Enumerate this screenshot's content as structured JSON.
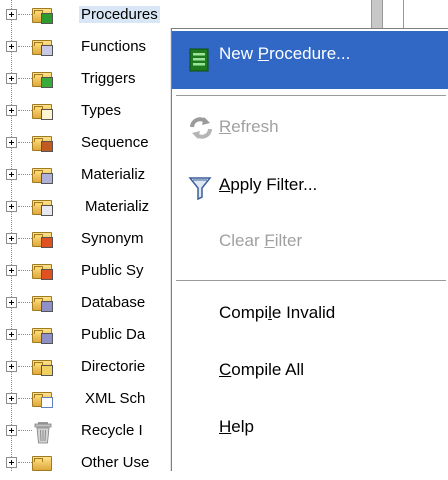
{
  "tree": {
    "items": [
      {
        "label": "Procedures",
        "icon": "procedures-folder-icon",
        "color": "#2e9b2e"
      },
      {
        "label": "Functions",
        "icon": "functions-folder-icon",
        "color": "#6d6d9c"
      },
      {
        "label": "Triggers",
        "icon": "triggers-folder-icon",
        "color": "#2e9b2e"
      },
      {
        "label": "Types",
        "icon": "types-folder-icon",
        "color": "#c08020"
      },
      {
        "label": "Sequence",
        "icon": "sequences-folder-icon",
        "color": "#c04020"
      },
      {
        "label": "Materializ",
        "icon": "materialized-view-folder-icon",
        "color": "#6d6d9c"
      },
      {
        "label": "Materializ",
        "icon": "materialized-view-log-folder-icon",
        "color": "#808080"
      },
      {
        "label": "Synonym",
        "icon": "synonyms-folder-icon",
        "color": "#d04a20"
      },
      {
        "label": "Public Sy",
        "icon": "public-synonyms-folder-icon",
        "color": "#d04a20"
      },
      {
        "label": "Database",
        "icon": "database-links-folder-icon",
        "color": "#6060a0"
      },
      {
        "label": "Public Da",
        "icon": "public-database-links-folder-icon",
        "color": "#6060a0"
      },
      {
        "label": "Directorie",
        "icon": "directories-folder-icon",
        "color": "#c8a020"
      },
      {
        "label": "XML Sch",
        "icon": "xml-schemas-folder-icon",
        "color": "#6080c0"
      },
      {
        "label": "Recycle I",
        "icon": "recycle-bin-icon",
        "color": "#909090"
      },
      {
        "label": "Other Use",
        "icon": "other-users-folder-icon",
        "color": "#c08020"
      }
    ]
  },
  "menu": {
    "items": [
      {
        "label_pre": "New ",
        "label_u": "P",
        "label_post": "rocedure...",
        "icon": "new-procedure-icon",
        "state": "highlighted"
      },
      {
        "label_pre": "",
        "label_u": "R",
        "label_post": "efresh",
        "icon": "refresh-icon",
        "state": "disabled"
      },
      {
        "label_pre": "",
        "label_u": "A",
        "label_post": "pply Filter...",
        "icon": "filter-icon",
        "state": "enabled"
      },
      {
        "label_pre": "Clear ",
        "label_u": "F",
        "label_post": "ilter",
        "icon": "",
        "state": "disabled"
      },
      {
        "label_pre": "Compi",
        "label_u": "l",
        "label_post": "e Invalid",
        "icon": "",
        "state": "enabled"
      },
      {
        "label_pre": "",
        "label_u": "C",
        "label_post": "ompile All",
        "icon": "",
        "state": "enabled"
      },
      {
        "label_pre": "",
        "label_u": "H",
        "label_post": "elp",
        "icon": "",
        "state": "enabled"
      }
    ]
  },
  "colors": {
    "highlight": "#3168c6",
    "disabled_text": "#a0a0a0",
    "selected_row": "#d9e6f5"
  }
}
